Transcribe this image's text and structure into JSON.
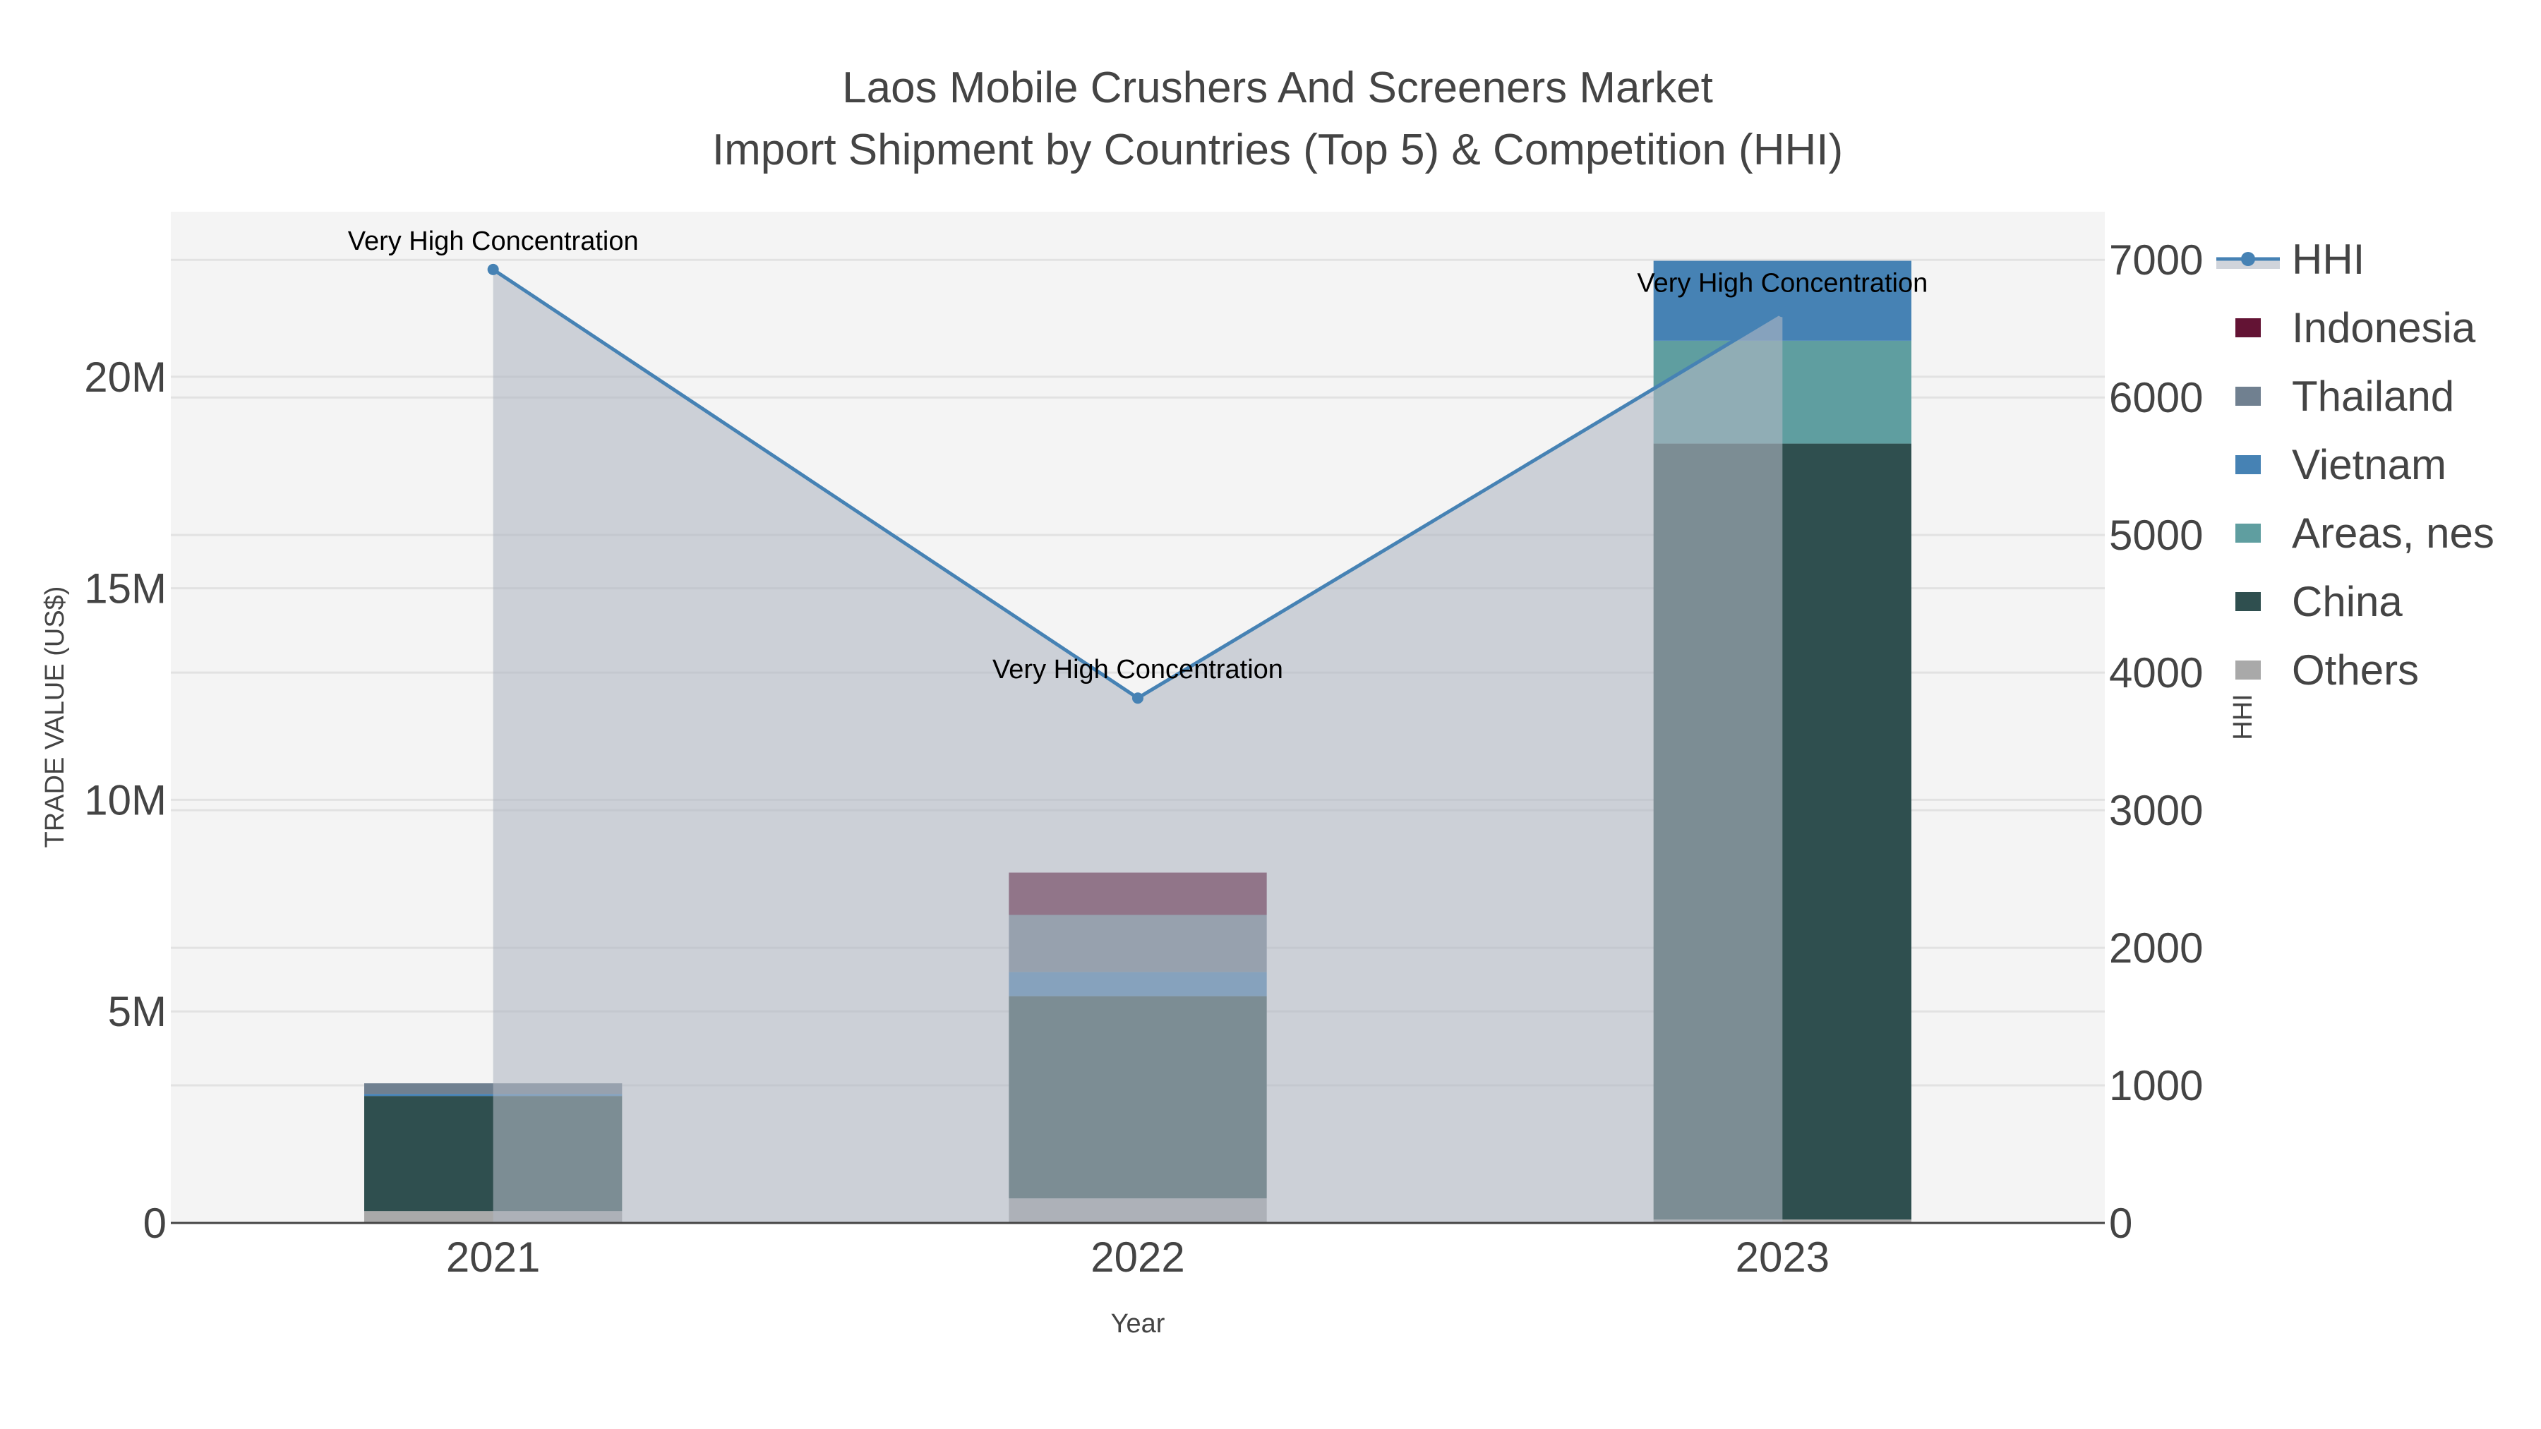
{
  "chart_data": {
    "type": "bar",
    "title": "Laos Mobile Crushers And Screeners Market",
    "subtitle": "Import Shipment by Countries (Top 5) & Competition (HHI)",
    "xlabel": "Year",
    "ylabel": "TRADE VALUE (US$)",
    "y2label": "HHI",
    "categories": [
      "2021",
      "2022",
      "2023"
    ],
    "ylim": [
      0,
      23900000
    ],
    "y2lim": [
      0,
      7350
    ],
    "yticks": [
      {
        "v": 0,
        "label": "0"
      },
      {
        "v": 5000000,
        "label": "5M"
      },
      {
        "v": 10000000,
        "label": "10M"
      },
      {
        "v": 15000000,
        "label": "15M"
      },
      {
        "v": 20000000,
        "label": "20M"
      }
    ],
    "y2ticks": [
      0,
      1000,
      2000,
      3000,
      4000,
      5000,
      6000,
      7000
    ],
    "grid": true,
    "barmode": "stack",
    "series": [
      {
        "name": "Others",
        "color": "#A9A9A9",
        "values": [
          280000,
          580000,
          80000
        ]
      },
      {
        "name": "China",
        "color": "#2F4F4F",
        "values": [
          2720000,
          4780000,
          18340000
        ]
      },
      {
        "name": "Areas, nes",
        "color": "#5F9EA0",
        "values": [
          0,
          0,
          2430000
        ]
      },
      {
        "name": "Vietnam",
        "color": "#4682B4",
        "values": [
          50000,
          570000,
          1890000
        ]
      },
      {
        "name": "Thailand",
        "color": "#708090",
        "values": [
          250000,
          1350000,
          0
        ]
      },
      {
        "name": "Indonesia",
        "color": "#631334",
        "values": [
          0,
          1000000,
          0
        ]
      }
    ],
    "hhi": {
      "name": "HHI",
      "type": "line",
      "color": "#4682B4",
      "fill": "#b0b7c3",
      "values": [
        6930,
        3815,
        6625
      ],
      "annotations": [
        "Very High Concentration",
        "Very High Concentration",
        "Very High Concentration"
      ]
    },
    "legend": {
      "placement": "right",
      "order": [
        "HHI",
        "Indonesia",
        "Thailand",
        "Vietnam",
        "Areas, nes",
        "China",
        "Others"
      ]
    }
  }
}
